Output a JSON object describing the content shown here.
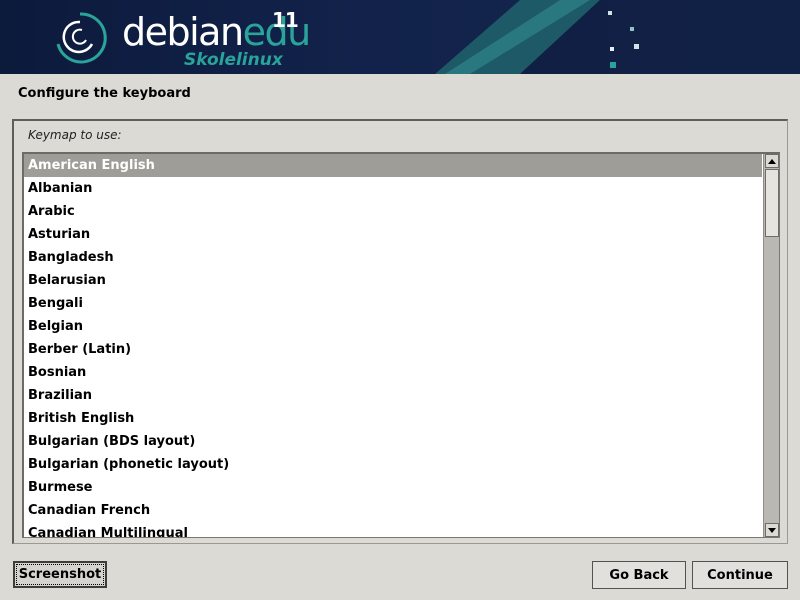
{
  "banner": {
    "brand_part1": "debian",
    "brand_part2": "edu",
    "version": "11",
    "subtitle": "Skolelinux"
  },
  "page": {
    "title": "Configure the keyboard"
  },
  "keymap": {
    "label": "Keymap to use:",
    "selected": "American English",
    "options": [
      "American English",
      "Albanian",
      "Arabic",
      "Asturian",
      "Bangladesh",
      "Belarusian",
      "Bengali",
      "Belgian",
      "Berber (Latin)",
      "Bosnian",
      "Brazilian",
      "British English",
      "Bulgarian (BDS layout)",
      "Bulgarian (phonetic layout)",
      "Burmese",
      "Canadian French",
      "Canadian Multilingual"
    ]
  },
  "buttons": {
    "screenshot": "Screenshot",
    "go_back": "Go Back",
    "continue": "Continue"
  },
  "colors": {
    "banner_bg": "#0c1a3c",
    "accent_teal": "#2aa39a",
    "selection_bg": "#9f9d98",
    "window_bg": "#dcdad5"
  }
}
